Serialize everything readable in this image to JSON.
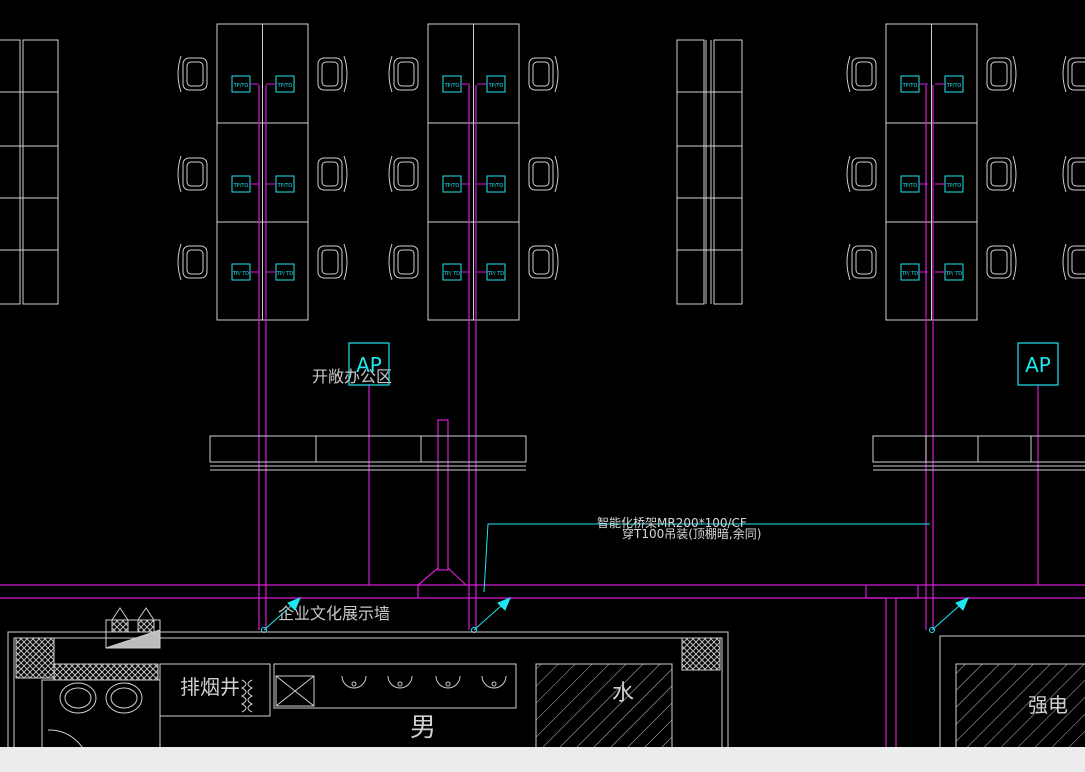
{
  "labels": {
    "open_office": "开敞办公区",
    "ap": "AP",
    "tray_line1": "智能化桥架MR200*100/CF",
    "tray_line2": "穿T100吊装(顶棚暗,余同)",
    "culture_wall": "企业文化展示墙",
    "smoke_shaft": "排烟井",
    "male": "男",
    "water": "水",
    "strong_power": "强电",
    "outlet_a": "TP/TO",
    "outlet_b": "TP/ TD"
  },
  "colors": {
    "background": "#000000",
    "wall": "#cfcfcf",
    "cable": "#d21ed2",
    "device": "#1ee6f0",
    "text": "#c8c8c8"
  }
}
